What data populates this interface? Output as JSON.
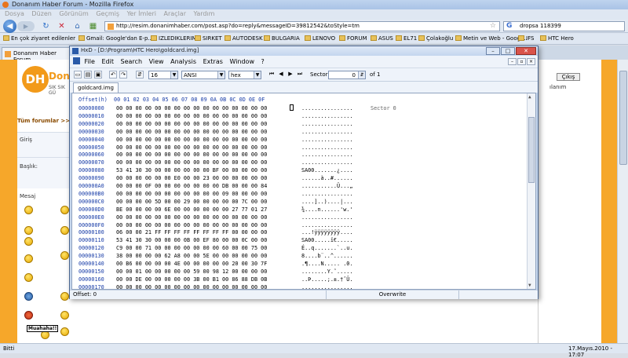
{
  "browser": {
    "title": "Donanım Haber Forum - Mozilla Firefox",
    "menu": [
      "Dosya",
      "Düzen",
      "Görünüm",
      "Geçmiş",
      "Yer İmleri",
      "Araçlar",
      "Yardım"
    ],
    "url": "http://resim.donanimhaber.com/post.asp?do=reply&messageID=39812542&toStyle=tm",
    "search_value": "dropsa 118399",
    "bookmarks": [
      "En çok ziyaret edilenler",
      "Gmail: Google'dan E-p...",
      "IZLEDIKLERIM",
      "SIRKET",
      "AUTODESK",
      "BULGARIA",
      "LENOVO",
      "FORUM",
      "ASUS",
      "EL71",
      "Çolakoğlu",
      "Metin ve Web - Googl...",
      "IFS",
      "HTC Hero"
    ],
    "tab": "Donanım Haber Forum",
    "status_left": "Bitti",
    "status_right": "17.Mayıs.2010 - 17:07"
  },
  "page": {
    "logo_letter": "DH",
    "logo_text": "Don",
    "logo_sub": "SIK SIK GÜ",
    "all_forums": "Tüm forumlar >>",
    "labels": {
      "giris": "Giriş",
      "baslik": "Başlık:",
      "mesaj": "Mesaj"
    },
    "right_button": "Çıkış",
    "right_text": "ılanım",
    "muahaha": "Muahaha!!"
  },
  "hxd": {
    "title": "HxD - [D:\\Program\\HTC Hero\\goldcard.img]",
    "window_buttons": [
      "–",
      "□",
      "✕"
    ],
    "menu": [
      "File",
      "Edit",
      "Search",
      "View",
      "Analysis",
      "Extras",
      "Window",
      "?"
    ],
    "bytes_per_row": "16",
    "charset": "ANSI",
    "display": "hex",
    "sector_label": "Sector",
    "sector_value": "0",
    "sector_of": "of 1",
    "file_tab": "goldcard.img",
    "header": "Offset(h)  00 01 02 03 04 05 06 07 08 09 0A 0B 0C 0D 0E 0F",
    "sector_marker": "Sector 0",
    "rows": [
      {
        "off": "00000000",
        "hex": "00 00 00 00 00 00 00 00 00 00 00 00 00 00 00 00",
        "asc": "................"
      },
      {
        "off": "00000010",
        "hex": "00 00 00 00 00 00 00 00 00 00 00 00 00 00 00 00",
        "asc": "................"
      },
      {
        "off": "00000020",
        "hex": "00 00 00 00 00 00 00 00 00 00 00 00 00 00 00 00",
        "asc": "................"
      },
      {
        "off": "00000030",
        "hex": "00 00 00 00 00 00 00 00 00 00 00 00 00 00 00 00",
        "asc": "................"
      },
      {
        "off": "00000040",
        "hex": "00 00 00 00 00 00 00 00 00 00 00 00 00 00 00 00",
        "asc": "................"
      },
      {
        "off": "00000050",
        "hex": "00 00 00 00 00 00 00 00 00 00 00 00 00 00 00 00",
        "asc": "................"
      },
      {
        "off": "00000060",
        "hex": "00 00 00 00 00 00 00 00 00 00 00 00 00 00 00 00",
        "asc": "................"
      },
      {
        "off": "00000070",
        "hex": "00 00 00 00 00 00 00 00 00 00 00 00 00 00 00 00",
        "asc": "................"
      },
      {
        "off": "00000080",
        "hex": "53 41 30 30 00 00 00 00 00 00 BF 00 00 00 00 00",
        "asc": "SA00.......¿...."
      },
      {
        "off": "00000090",
        "hex": "00 00 00 00 00 00 E0 00 00 23 00 00 00 00 00 00",
        "asc": "......à..#......"
      },
      {
        "off": "000000A0",
        "hex": "00 00 00 0F 00 00 00 00 00 00 00 DB 00 00 00 84",
        "asc": "...........Û...„"
      },
      {
        "off": "000000B0",
        "hex": "00 00 00 00 00 00 00 00 00 00 00 09 00 00 00 00",
        "asc": "................"
      },
      {
        "off": "000000C0",
        "hex": "00 00 00 00 5D 00 00 29 00 00 00 00 00 7C 00 00",
        "asc": "....]..)....|..."
      },
      {
        "off": "000000D0",
        "hex": "BE 00 00 00 00 6E 00 00 00 00 00 00 27 77 01 27",
        "asc": "¾....n......'w.'"
      },
      {
        "off": "000000E0",
        "hex": "00 00 00 00 00 00 00 00 00 00 00 00 00 00 00 00",
        "asc": "................"
      },
      {
        "off": "000000F0",
        "hex": "00 00 00 00 00 00 00 00 00 00 00 00 00 00 00 00",
        "asc": "................"
      },
      {
        "off": "00000100",
        "hex": "06 00 00 21 FF FF FF FF FF FF FF FF 00 00 00 00",
        "asc": "...!ÿÿÿÿÿÿÿÿ...."
      },
      {
        "off": "00000110",
        "hex": "53 41 30 30 00 00 00 0B 00 EF 80 00 00 0C 00 00",
        "asc": "SA00.....ï€....."
      },
      {
        "off": "00000120",
        "hex": "C9 00 00 71 00 00 00 00 00 00 00 60 00 00 75 00",
        "asc": "É..q.......`..u."
      },
      {
        "off": "00000130",
        "hex": "38 00 00 00 00 62 A8 00 00 5E 00 00 00 00 00 00",
        "asc": "8....b¨..^......"
      },
      {
        "off": "00000140",
        "hex": "00 B6 00 00 00 00 4E 00 00 00 00 00 20 00 30 7F",
        "asc": ".¶....N..... .0."
      },
      {
        "off": "00000150",
        "hex": "00 00 01 00 00 00 00 00 59 00 98 12 00 00 00 00",
        "asc": "........Y.˜....."
      },
      {
        "off": "00000160",
        "hex": "00 00 DE 00 00 00 00 00 3B 00 B1 00 86 88 DB 0B",
        "asc": "..Þ.....;.±.†ˆÛ."
      },
      {
        "off": "00000170",
        "hex": "00 00 00 00 00 00 00 00 00 00 00 00 00 00 00 00",
        "asc": "................"
      }
    ],
    "status_offset": "Offset: 0",
    "status_mode": "Overwrite"
  }
}
